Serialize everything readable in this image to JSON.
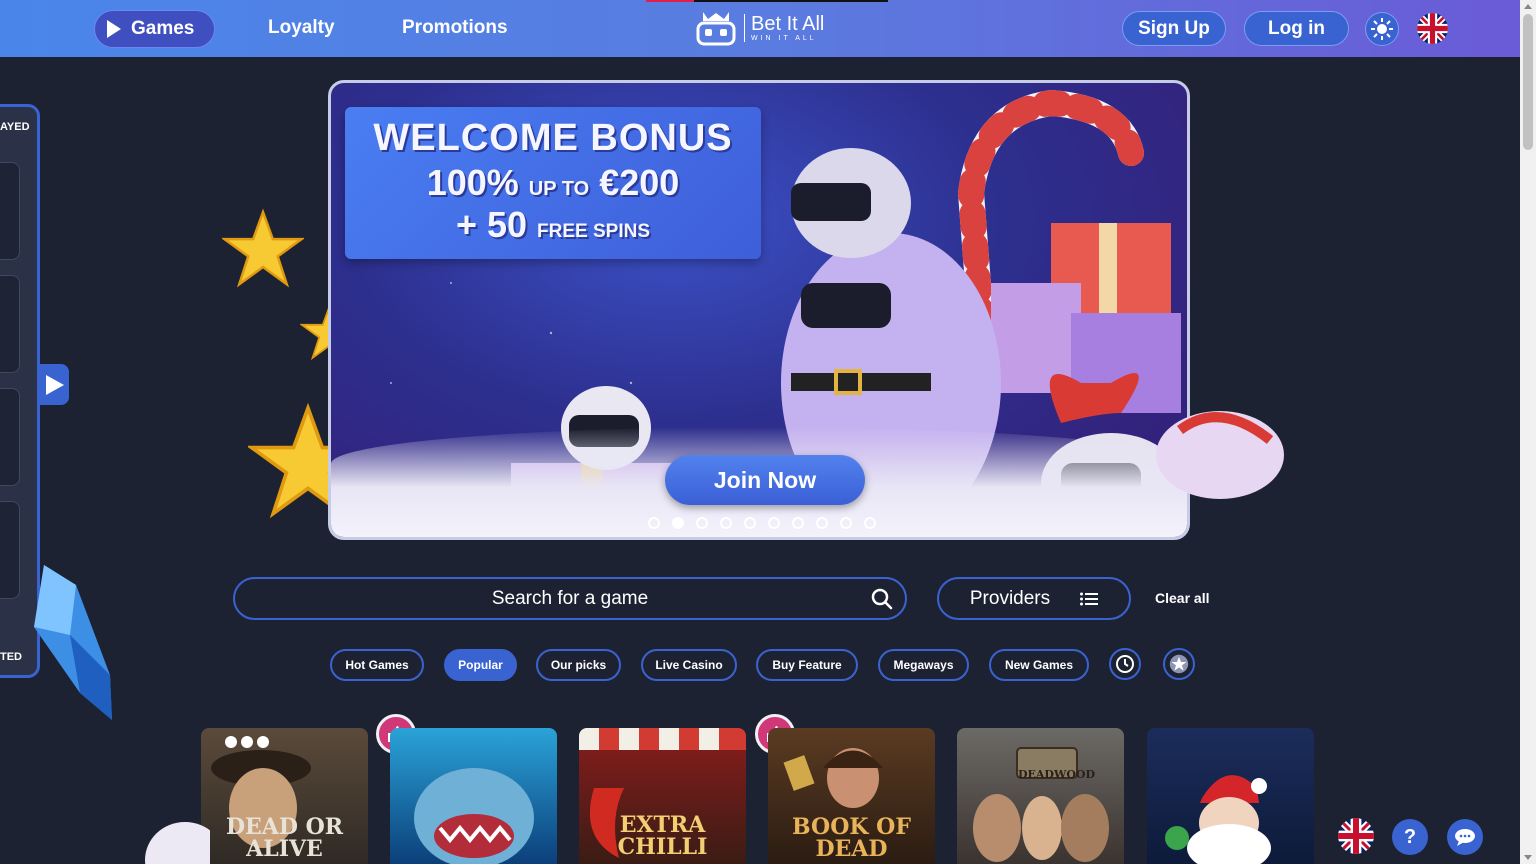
{
  "header": {
    "nav": {
      "games": "Games",
      "loyalty": "Loyalty",
      "promotions": "Promotions"
    },
    "logo": {
      "title": "Bet It All",
      "tagline": "WIN IT ALL"
    },
    "sign_up": "Sign Up",
    "log_in": "Log in",
    "theme_icon": "sun-icon",
    "language_flag": "uk-flag-icon"
  },
  "sidebar": {
    "top_label": "AYED",
    "bottom_label": "TED",
    "toggle_icon": "arrow-right-icon"
  },
  "banner": {
    "title": "WELCOME BONUS",
    "line2_big1": "100%",
    "line2_small": "UP TO",
    "line2_big2": "€200",
    "line3_big": "+ 50",
    "line3_small": "FREE SPINS",
    "cta": "Join Now",
    "slide_count": 10,
    "active_slide": 2
  },
  "search": {
    "placeholder": "Search for a game",
    "providers_label": "Providers",
    "clear_all": "Clear all"
  },
  "categories": [
    "Hot Games",
    "Popular",
    "Our picks",
    "Live Casino",
    "Buy Feature",
    "Megaways",
    "New Games"
  ],
  "active_category": "Popular",
  "category_icons": [
    "history-icon",
    "favorites-star-icon"
  ],
  "games": [
    {
      "label": "DEAD OR ALIVE"
    },
    {
      "label": ""
    },
    {
      "label": "EXTRA CHILLI"
    },
    {
      "label": "BOOK OF DEAD"
    },
    {
      "label": "DEADWOOD"
    },
    {
      "label": ""
    }
  ],
  "colors": {
    "accent": "#3a63d2",
    "background": "#1d2233",
    "badge": "#d1387a"
  },
  "floating": [
    "uk-flag-icon",
    "help-icon",
    "chat-icon"
  ]
}
